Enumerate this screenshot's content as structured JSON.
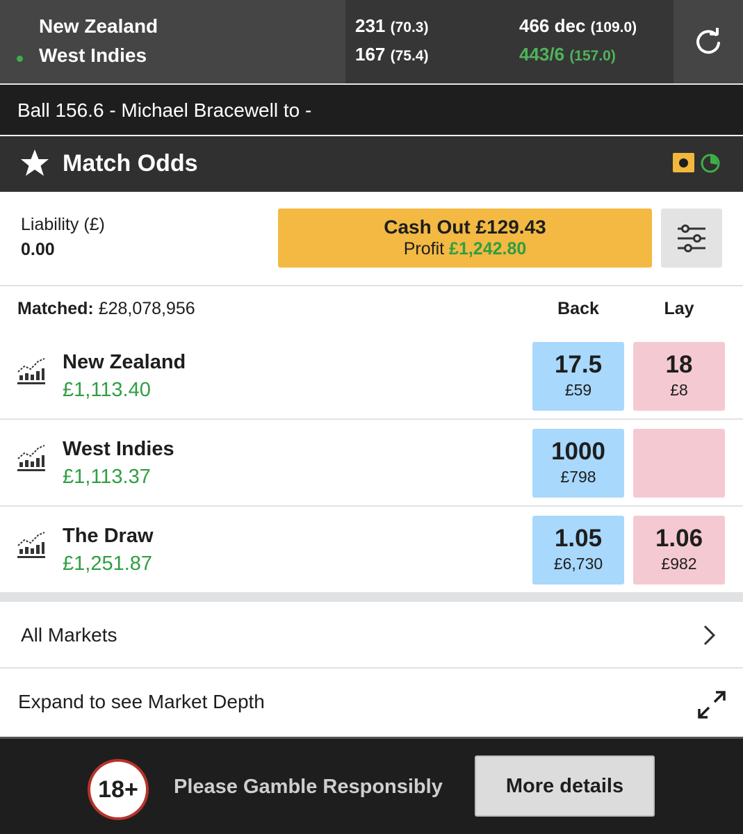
{
  "scoreboard": {
    "team1": "New Zealand",
    "team2": "West Indies",
    "team1_inn1_score": "231",
    "team1_inn1_overs": "(70.3)",
    "team2_inn1_score": "167",
    "team2_inn1_overs": "(75.4)",
    "team1_inn2_score": "466 dec",
    "team1_inn2_overs": "(109.0)",
    "team2_inn2_score": "443/6",
    "team2_inn2_overs": "(157.0)",
    "batting_indicator_color": "#3fae49",
    "refresh_icon": "refresh-icon"
  },
  "ball_commentary": "Ball 156.6 - Michael Bracewell to -",
  "market": {
    "title": "Match Odds",
    "star_icon": "star-icon",
    "inplay_icon": "inplay-icon",
    "timer_icon": "timer-icon"
  },
  "liability": {
    "label": "Liability (£)",
    "value": "0.00"
  },
  "cashout": {
    "label": "Cash Out £129.43",
    "profit_label": "Profit",
    "profit_value": "£1,242.80",
    "color": "#f3b942"
  },
  "settings_icon": "sliders-icon",
  "table": {
    "matched_label": "Matched:",
    "matched_value": "£28,078,956",
    "back_header": "Back",
    "lay_header": "Lay"
  },
  "runners": [
    {
      "name": "New Zealand",
      "pl": "£1,113.40",
      "back_price": "17.5",
      "back_size": "£59",
      "lay_price": "18",
      "lay_size": "£8"
    },
    {
      "name": "West Indies",
      "pl": "£1,113.37",
      "back_price": "1000",
      "back_size": "£798",
      "lay_price": "",
      "lay_size": ""
    },
    {
      "name": "The Draw",
      "pl": "£1,251.87",
      "back_price": "1.05",
      "back_size": "£6,730",
      "lay_price": "1.06",
      "lay_size": "£982"
    }
  ],
  "links": {
    "all_markets": "All Markets",
    "market_depth": "Expand to see Market Depth"
  },
  "footer": {
    "age_badge": "18+",
    "message": "Please Gamble Responsibly",
    "more_details": "More details"
  },
  "colors": {
    "back": "#a8d8fc",
    "lay": "#f5c9d2",
    "profit_green": "#2f9e42",
    "header_dark": "#303030"
  }
}
